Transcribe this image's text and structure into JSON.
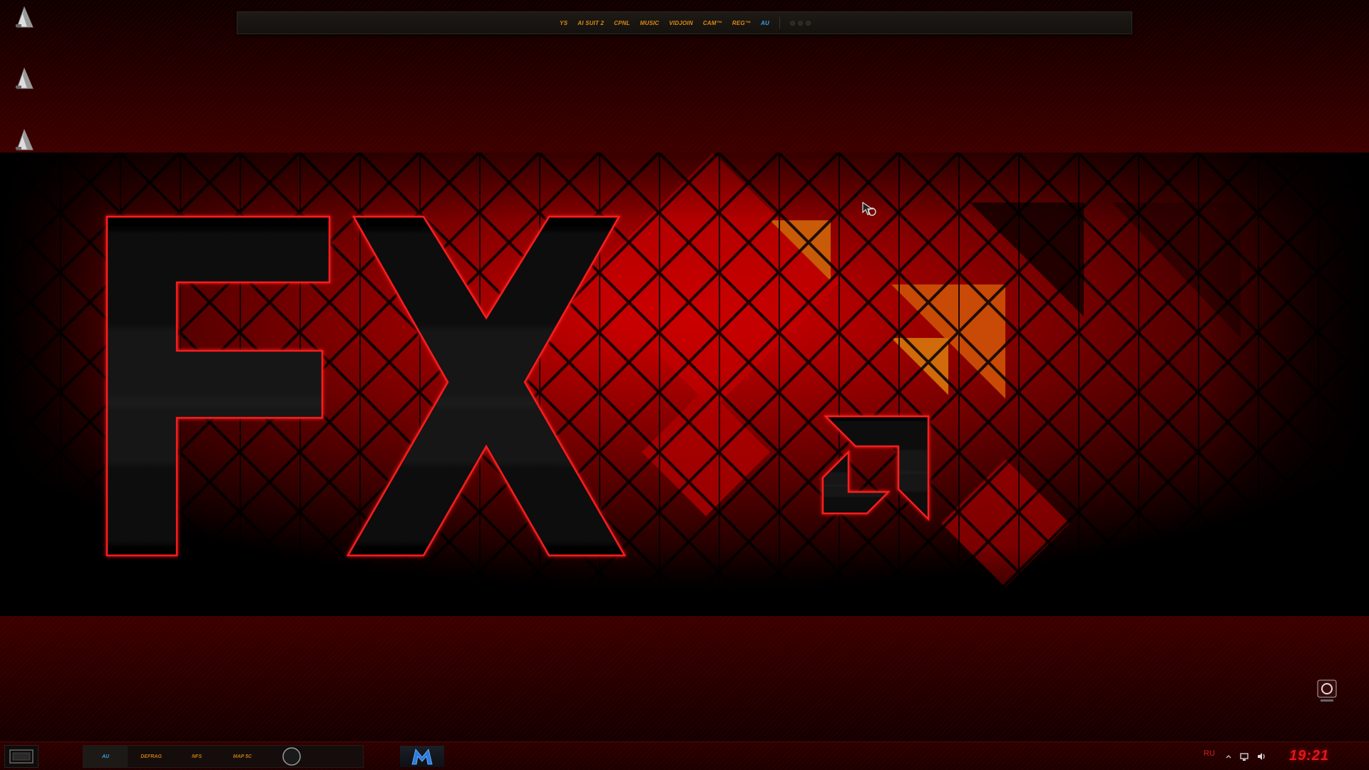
{
  "topbar": {
    "items": [
      {
        "label": "YS",
        "color": "#d98a14"
      },
      {
        "label": "AI SUIT 2",
        "color": "#d98a14"
      },
      {
        "label": "CPNL",
        "color": "#d98a14"
      },
      {
        "label": "MUSIC",
        "color": "#d98a14"
      },
      {
        "label": "VIDJOIN",
        "color": "#d98a14"
      },
      {
        "label": "CAM™",
        "color": "#d98a14"
      },
      {
        "label": "REG™",
        "color": "#d98a14"
      },
      {
        "label": "AU",
        "color": "#3aa0e8"
      }
    ]
  },
  "desktop_icons": [
    {
      "icon": "shortcut-icon"
    },
    {
      "icon": "shortcut-icon"
    },
    {
      "icon": "shortcut-icon"
    }
  ],
  "wallpaper": {
    "logo_text": "FX",
    "logo_mark": "amd-arrow-logo",
    "colors": {
      "accent": "#e0141a",
      "orange": "#d05a0a",
      "dark": "#0a0000"
    }
  },
  "corner_icon": {
    "icon": "app-tray-icon"
  },
  "taskbar": {
    "items": [
      {
        "label": "AU",
        "active": true
      },
      {
        "label": "DEFRAG",
        "active": false
      },
      {
        "label": "NFS",
        "active": false
      },
      {
        "label": "MAP 5C",
        "active": false
      }
    ],
    "apps": [
      {
        "icon": "circle-app-icon"
      },
      {
        "icon": "malwarebytes-icon"
      }
    ]
  },
  "tray": {
    "language": "RU",
    "icons": [
      "chevron-up-icon",
      "network-icon",
      "volume-icon"
    ],
    "clock": "19:21"
  }
}
